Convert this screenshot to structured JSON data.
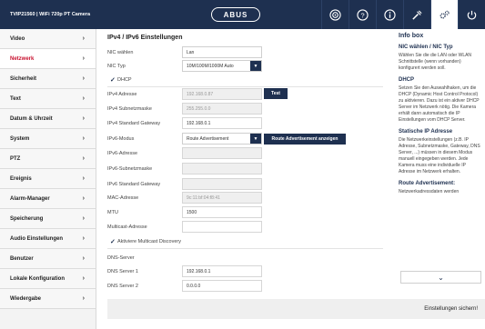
{
  "topbar": {
    "title": "TVIP21560 | WiFi 720p PT Camera",
    "logo": "ABUS",
    "icons": [
      "bullseye-icon",
      "help-icon",
      "info-icon",
      "tools-icon",
      "settings-gears-icon",
      "power-icon"
    ]
  },
  "sidebar": {
    "items": [
      {
        "label": "Video",
        "active": false
      },
      {
        "label": "Netzwerk",
        "active": true
      },
      {
        "label": "Sicherheit",
        "active": false
      },
      {
        "label": "Text",
        "active": false
      },
      {
        "label": "Datum & Uhrzeit",
        "active": false
      },
      {
        "label": "System",
        "active": false
      },
      {
        "label": "PTZ",
        "active": false
      },
      {
        "label": "Ereignis",
        "active": false
      },
      {
        "label": "Alarm-Manager",
        "active": false
      },
      {
        "label": "Speicherung",
        "active": false
      },
      {
        "label": "Audio Einstellungen",
        "active": false
      },
      {
        "label": "Benutzer",
        "active": false
      },
      {
        "label": "Lokale Konfiguration",
        "active": false
      },
      {
        "label": "Wiedergabe",
        "active": false
      }
    ],
    "chevron": "›"
  },
  "main": {
    "title": "IPv4 / IPv6 Einstellungen",
    "nic_select_label": "NIC wählen",
    "nic_select_value": "Lan",
    "nic_type_label": "NIC Typ",
    "nic_type_value": "10M/100M/1000M Auto",
    "dhcp_label": "DHCP",
    "ipv4_address_label": "IPv4 Adresse",
    "ipv4_address_value": "192.168.0.87",
    "test_button": "Test",
    "ipv4_subnet_label": "IPv4 Subnetzmaske",
    "ipv4_subnet_value": "255.255.0.0",
    "ipv4_gateway_label": "IPv4 Standard Gateway",
    "ipv4_gateway_value": "192.168.0.1",
    "ipv6_mode_label": "IPv6-Modus",
    "ipv6_mode_value": "Route Advertisement",
    "route_adv_button": "Route Advertisement anzeigen",
    "ipv6_address_label": "IPv6-Adresse",
    "ipv6_subnet_label": "IPv6-Subnetzmaske",
    "ipv6_gateway_label": "IPv6 Standard Gateway",
    "mac_label": "MAC-Adresse",
    "mac_value": "9c:11:bf:04:f8:41",
    "mtu_label": "MTU",
    "mtu_value": "1500",
    "multicast_label": "Multicast-Adresse",
    "multicast_discovery_label": "Aktiviere Multicast Discovery",
    "dns_server_label": "DNS-Server",
    "dns1_label": "DNS Server 1",
    "dns1_value": "192.168.0.1",
    "dns2_label": "DNS Server 2",
    "dns2_value": "0.0.0.0",
    "save_label": "Einstellungen sichern!"
  },
  "info": {
    "title": "Info box",
    "sections": [
      {
        "heading": "NIC wählen / NIC Typ",
        "text": "Wählen Sie die die LAN oder WLAN Schnittstelle (wenn vorhanden) konfigurert werden soll."
      },
      {
        "heading": "DHCP",
        "text": "Setzen Sie den Auswahlhaken, um die DHCP (Dynamic Host Control Protocol) zu aktivieren. Dazu ist ein aktiver DHCP Server im Netzwerk nötig. Die Kamera erhält dann automatisch die IP Einstellungen vom DHCP Server."
      },
      {
        "heading": "Statische IP Adresse",
        "text": "Die Netzwerkeinstellungen (z.B. IP Adresse, Subnetzmaske, Gateway, DNS Server, ...) müssen in diesem Modus manuell eingegeben werden. Jede Kamera muss eine individuelle IP Adresse im Netzwerk erhalten."
      },
      {
        "heading": "Route Advertisement:",
        "text": "Netzwerkadressdaten werden"
      }
    ],
    "scroll_icon": "chevron-down-icon"
  },
  "colors": {
    "navy": "#1e3050",
    "active_red": "#c8102e"
  }
}
